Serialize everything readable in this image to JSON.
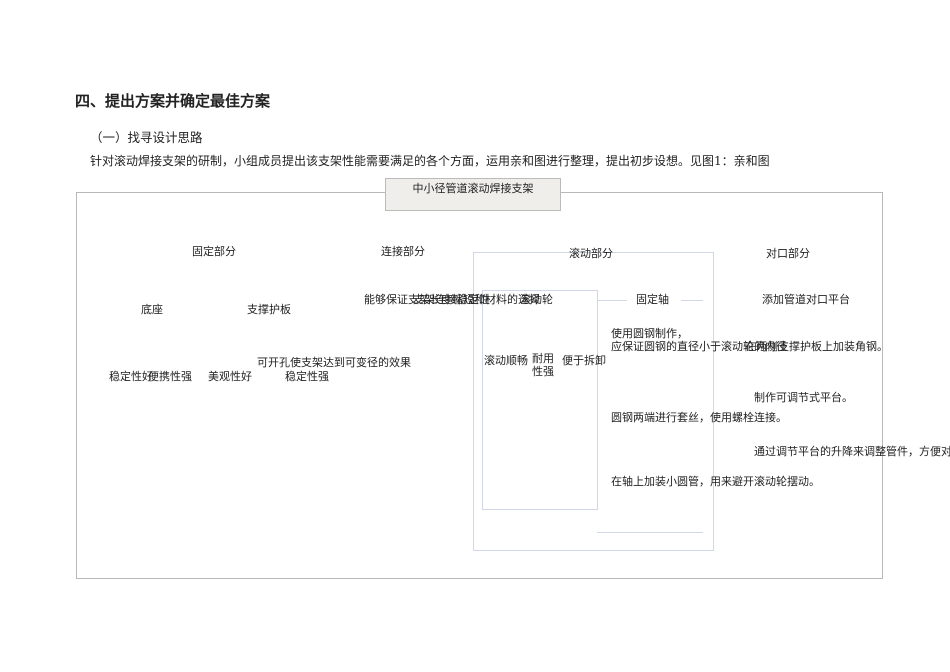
{
  "heading": "四、提出方案并确定最佳方案",
  "subheading": "（一）找寻设计思路",
  "paragraph": "针对滚动焊接支架的研制，小组成员提出该支架性能需要满足的各个方面，运用亲和图进行整理，提出初步设想。见图1：亲和图",
  "diagram": {
    "title": "中小径管道滚动焊接支架",
    "groups": [
      "固定部分",
      "连接部分",
      "滚动部分",
      "对口部分"
    ],
    "fixed": {
      "items": [
        "底座",
        "支撑护板"
      ],
      "attrs": [
        "稳定性好",
        "便携性强",
        "美观性好",
        "稳定性强"
      ],
      "note": "可开孔使支架达到可变径的效果"
    },
    "connect": {
      "t1": "能够保证支架长度缩短和材料的选择",
      "t2": "支架连接稳定性",
      "t3": "滚动轮"
    },
    "rolling": {
      "attrs": [
        "滚动顺畅",
        "耐用性强",
        "便于拆卸"
      ]
    },
    "axis": {
      "title": "固定轴",
      "l1": "使用圆钢制作，",
      "l2": "应保证圆钢的直径小于滚动轮的内径",
      "l3": "圆钢两端进行套丝，使用螺栓连接。",
      "l4": "在轴上加装小圆管，用来避开滚动轮摆动。"
    },
    "butt": {
      "title": "添加管道对口平台",
      "l1": "在两侧支撑护板上加装角钢。",
      "l2": "制作可调节式平台。",
      "l3": "通过调节平台的升降来调整管件，方便对口"
    }
  }
}
